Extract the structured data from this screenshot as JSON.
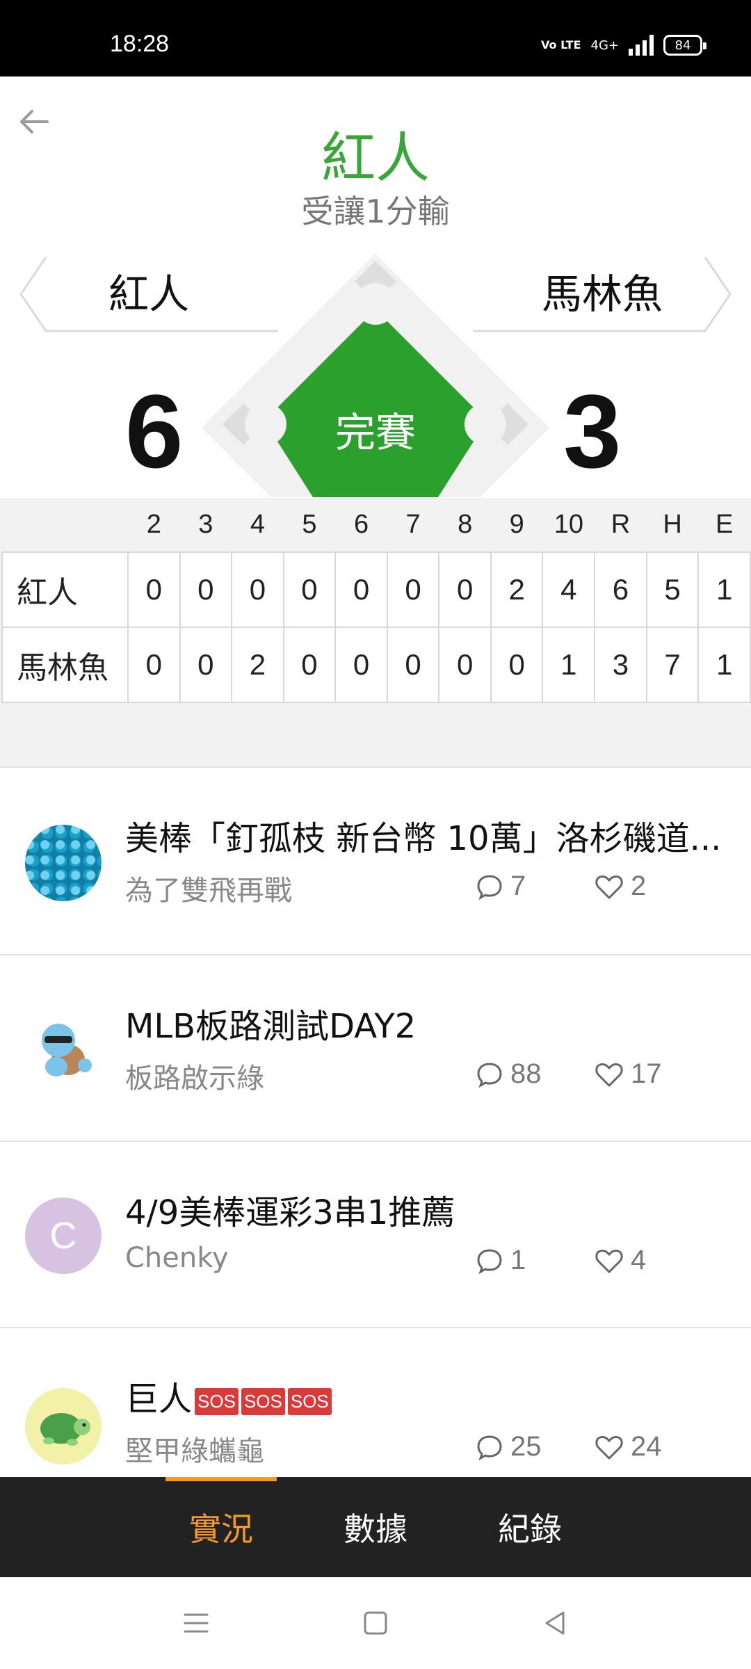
{
  "status_bar": {
    "time": "18:28",
    "network": "4G+",
    "volte": "Vo LTE",
    "battery": "84"
  },
  "header": {
    "winner": "紅人",
    "result": "受讓1分輸"
  },
  "game": {
    "away_team": "紅人",
    "home_team": "馬林魚",
    "away_score": "6",
    "home_score": "3",
    "status": "完賽"
  },
  "boxscore": {
    "headers": [
      "2",
      "3",
      "4",
      "5",
      "6",
      "7",
      "8",
      "9",
      "10",
      "R",
      "H",
      "E"
    ],
    "rows": [
      {
        "team": "紅人",
        "cells": [
          "0",
          "0",
          "0",
          "0",
          "0",
          "0",
          "0",
          "2",
          "4",
          "6",
          "5",
          "1"
        ]
      },
      {
        "team": "馬林魚",
        "cells": [
          "0",
          "0",
          "2",
          "0",
          "0",
          "0",
          "0",
          "0",
          "1",
          "3",
          "7",
          "1"
        ]
      }
    ]
  },
  "posts": [
    {
      "title": "美棒「釘孤枝 新台幣 10萬」洛杉磯道...",
      "author": "為了雙飛再戰",
      "comments": "7",
      "likes": "2"
    },
    {
      "title": "MLB板路測試DAY2",
      "author": "板路啟示綠",
      "comments": "88",
      "likes": "17"
    },
    {
      "title": "4/9美棒運彩3串1推薦",
      "author": "Chenky",
      "avatar_letter": "C",
      "comments": "1",
      "likes": "4"
    },
    {
      "title": "巨人",
      "sos": [
        "SOS",
        "SOS",
        "SOS"
      ],
      "author": "堅甲綠蠵龜",
      "comments": "25",
      "likes": "24"
    }
  ],
  "tabs": [
    {
      "label": "實況",
      "active": true
    },
    {
      "label": "數據",
      "active": false
    },
    {
      "label": "紀錄",
      "active": false
    }
  ],
  "colors": {
    "green": "#2ca02c",
    "accent": "#f39a2b",
    "tabbar": "#222222"
  }
}
